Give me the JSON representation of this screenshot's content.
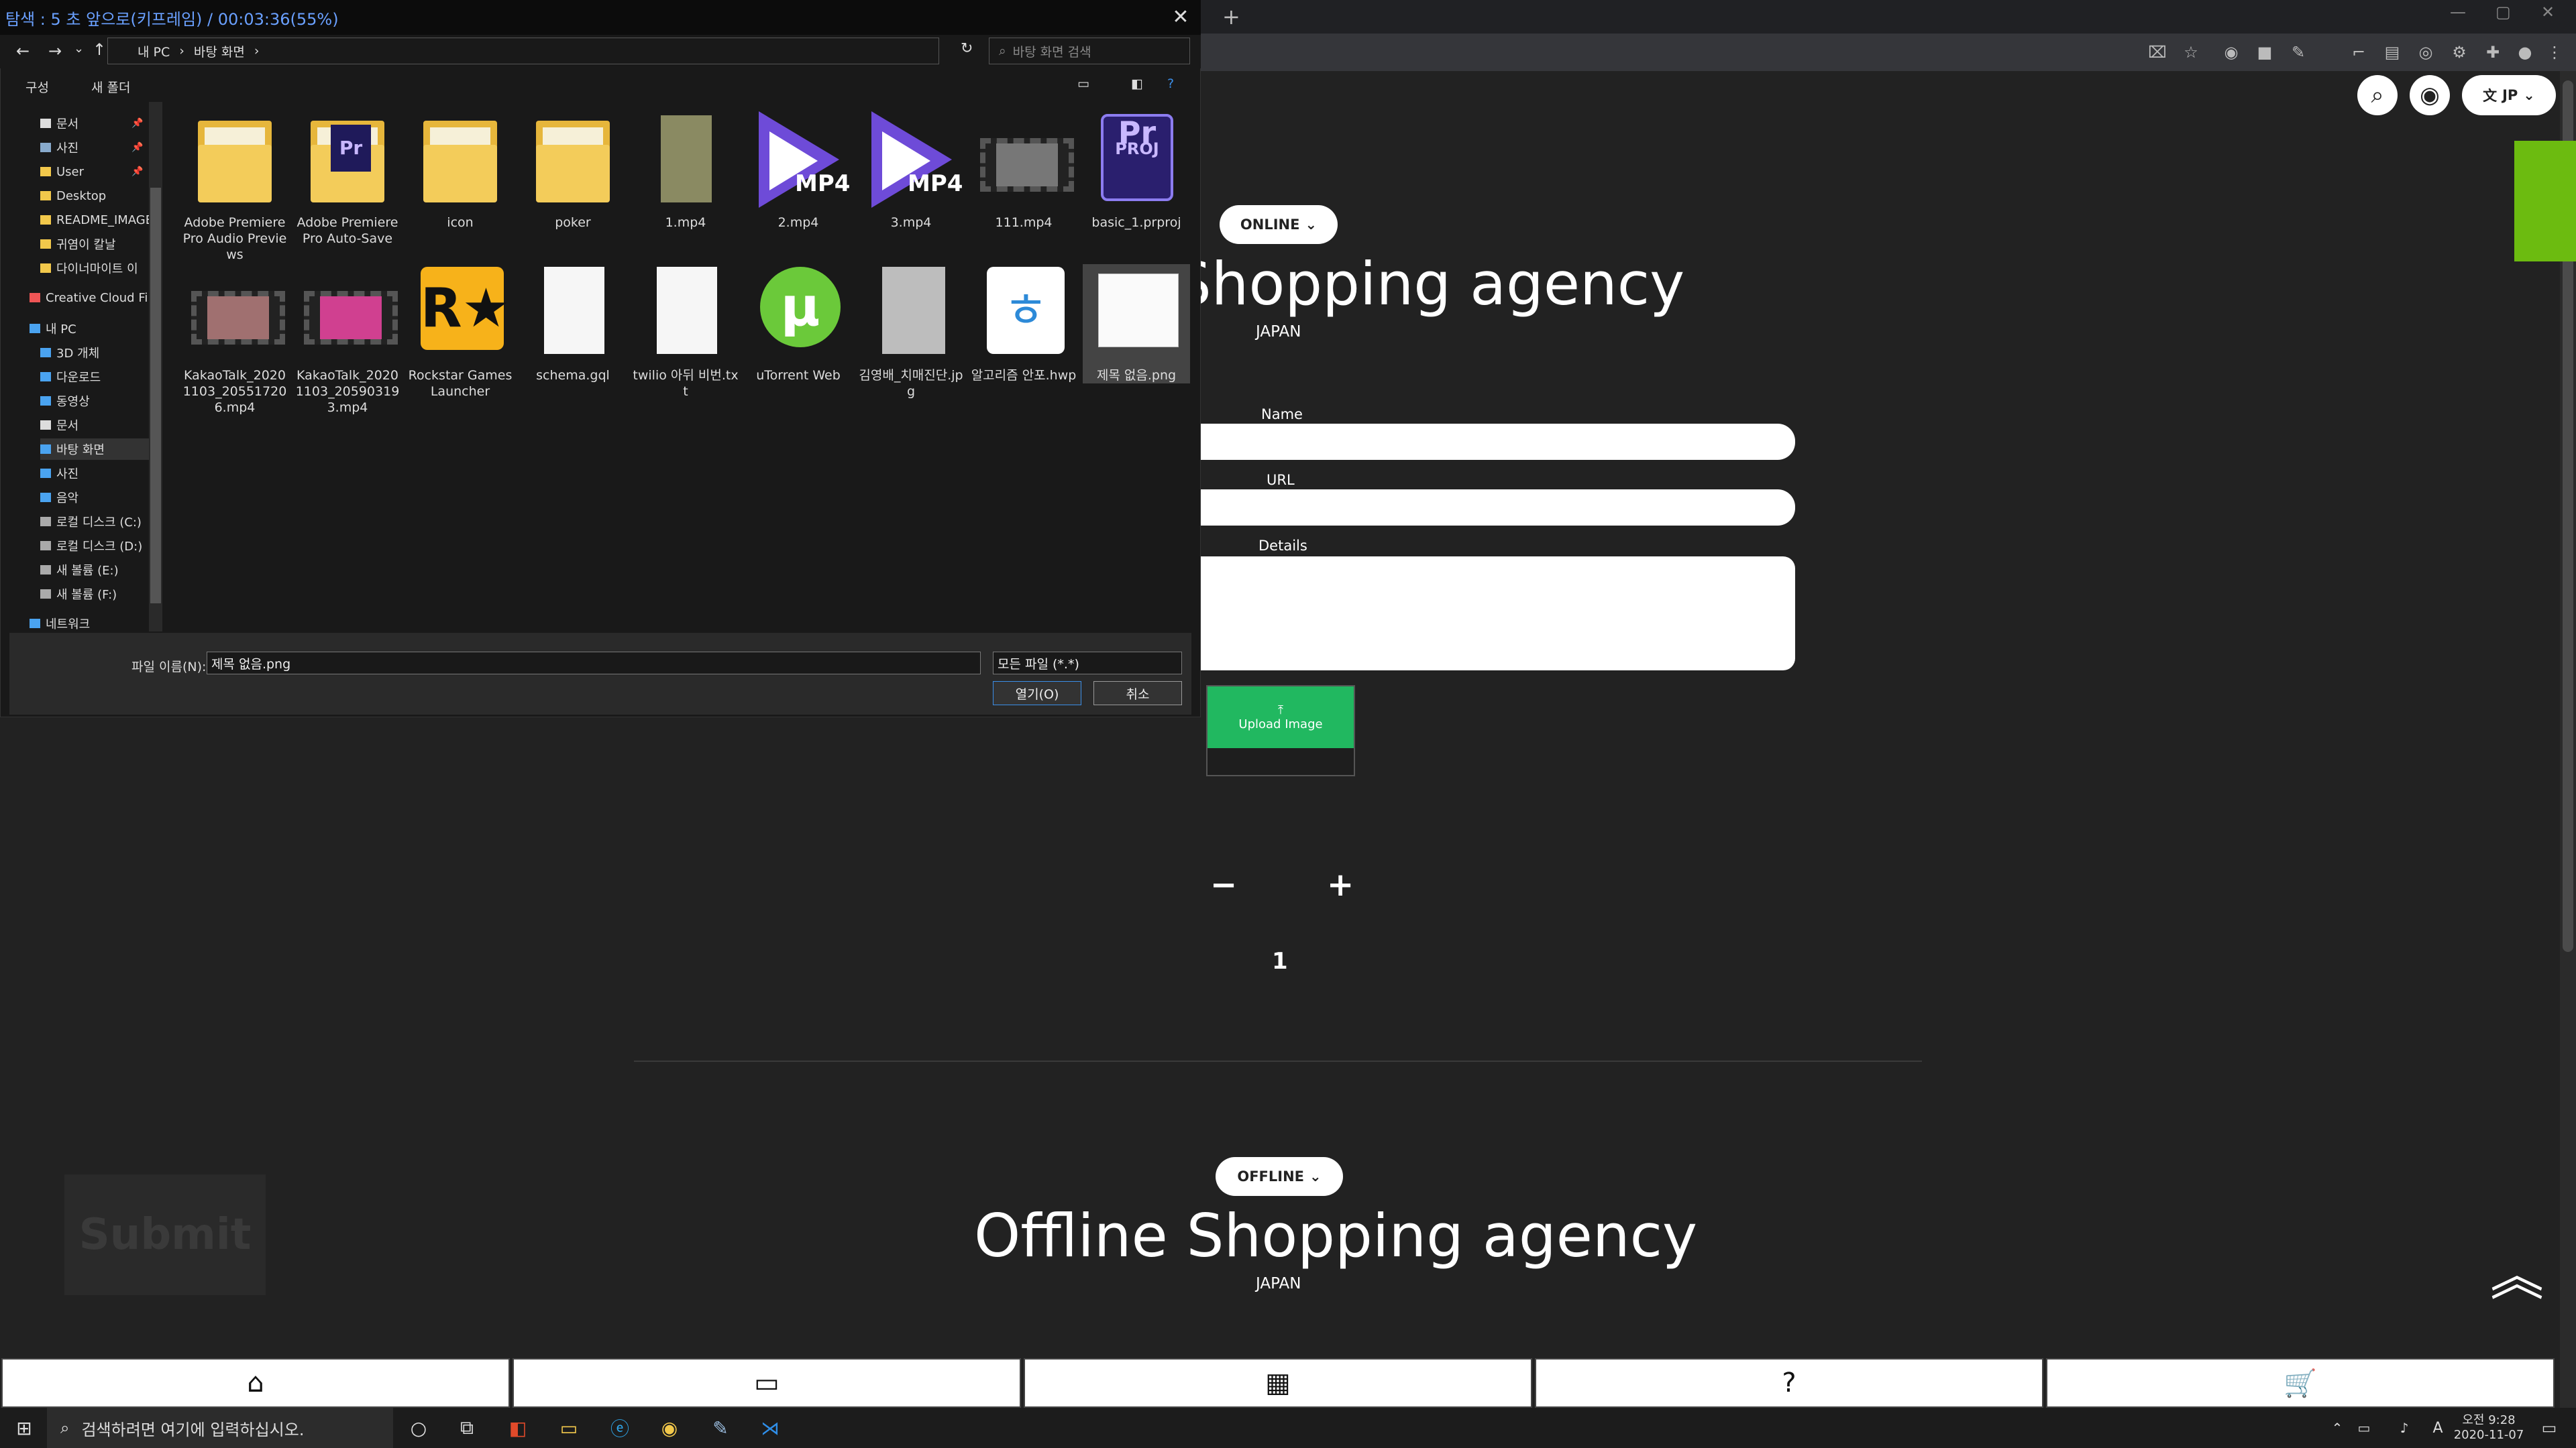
{
  "dialog": {
    "title": "탐색 : 5 초 앞으로(키프레임) / 00:03:36(55%)",
    "breadcrumb": [
      "내 PC",
      "바탕 화면"
    ],
    "search_placeholder": "바탕 화면 검색",
    "organize": "구성",
    "new_folder": "새 폴더",
    "nav_items": [
      "문서",
      "사진",
      "User",
      "Desktop",
      "README_IMAGE",
      "귀염이 칼날",
      "다이너마이트 이",
      "Creative Cloud Fil",
      "내 PC",
      "3D 개체",
      "다운로드",
      "동영상",
      "문서",
      "바탕 화면",
      "사진",
      "음악",
      "로컬 디스크 (C:)",
      "로컬 디스크 (D:)",
      "새 볼륨 (E:)",
      "새 볼륨 (F:)",
      "네트워크"
    ],
    "files": [
      {
        "name": "Adobe Premiere Pro Audio Previews"
      },
      {
        "name": "Adobe Premiere Pro Auto-Save"
      },
      {
        "name": "icon"
      },
      {
        "name": "poker"
      },
      {
        "name": "1.mp4"
      },
      {
        "name": "2.mp4"
      },
      {
        "name": "3.mp4"
      },
      {
        "name": "111.mp4"
      },
      {
        "name": "basic_1.prproj"
      },
      {
        "name": "KakaoTalk_20201103_205517206.mp4"
      },
      {
        "name": "KakaoTalk_20201103_205903193.mp4"
      },
      {
        "name": "Rockstar Games Launcher"
      },
      {
        "name": "schema.gql"
      },
      {
        "name": "twilio 아뒤 비번.txt"
      },
      {
        "name": "uTorrent Web"
      },
      {
        "name": "김영배_치매진단.jpg"
      },
      {
        "name": "알고리즘 안포.hwp"
      },
      {
        "name": "제목 없음.png"
      }
    ],
    "filename_label": "파일 이름(N):",
    "filename_value": "제목 없음.png",
    "filetype_value": "모든 파일 (*.*)",
    "open_label": "열기(O)",
    "cancel_label": "취소",
    "mp4_badge": "MP4",
    "pr_badge": "Pr",
    "proj_badge": "PROJ"
  },
  "header": {
    "lang": "JP"
  },
  "online": {
    "pill": "ONLINE",
    "title": "Online Shopping agency",
    "country": "JAPAN",
    "name_label": "Name",
    "url_label": "URL",
    "details_label": "Details",
    "upload_label": "Upload Image",
    "minus": "−",
    "plus": "+",
    "count": "1"
  },
  "offline": {
    "pill": "OFFLINE",
    "title": "Offline Shopping agency",
    "country": "JAPAN"
  },
  "submit_label": "Submit",
  "taskbar": {
    "search_placeholder": "검색하려면 여기에 입력하십시오.",
    "time": "오전 9:28",
    "date": "2020-11-07",
    "ime": "A"
  }
}
